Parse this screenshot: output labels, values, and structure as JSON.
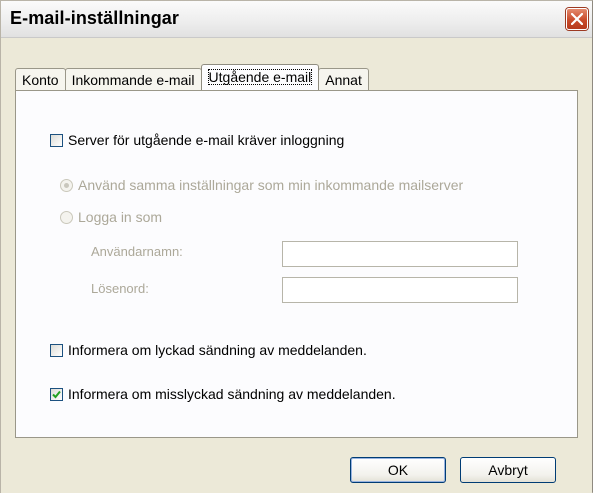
{
  "window": {
    "title": "E-mail-inställningar"
  },
  "tabs": [
    {
      "label": "Konto"
    },
    {
      "label": "Inkommande e-mail"
    },
    {
      "label": "Utgående e-mail"
    },
    {
      "label": "Annat"
    }
  ],
  "active_tab": "Utgående e-mail",
  "outgoing": {
    "require_login": {
      "label": "Server för utgående e-mail kräver inloggning",
      "checked": false
    },
    "radio_same": {
      "label": "Använd samma inställningar som min inkommande mailserver",
      "selected": true,
      "enabled": false
    },
    "radio_login": {
      "label": "Logga in som",
      "selected": false,
      "enabled": false
    },
    "username": {
      "label": "Användarnamn:",
      "value": ""
    },
    "password": {
      "label": "Lösenord:",
      "value": ""
    },
    "notify_success": {
      "label": "Informera om lyckad sändning av meddelanden.",
      "checked": false
    },
    "notify_failure": {
      "label": "Informera om misslyckad sändning av meddelanden.",
      "checked": true
    }
  },
  "buttons": {
    "ok": "OK",
    "cancel": "Avbryt"
  },
  "colors": {
    "dialog_bg": "#ece9d8",
    "panel_bg": "#fcfcfe",
    "close_button": "#c94b2a",
    "checkmark": "#21a121",
    "disabled_text": "#aca899"
  },
  "icons": {
    "close": "close-icon",
    "check": "checkmark-icon"
  }
}
